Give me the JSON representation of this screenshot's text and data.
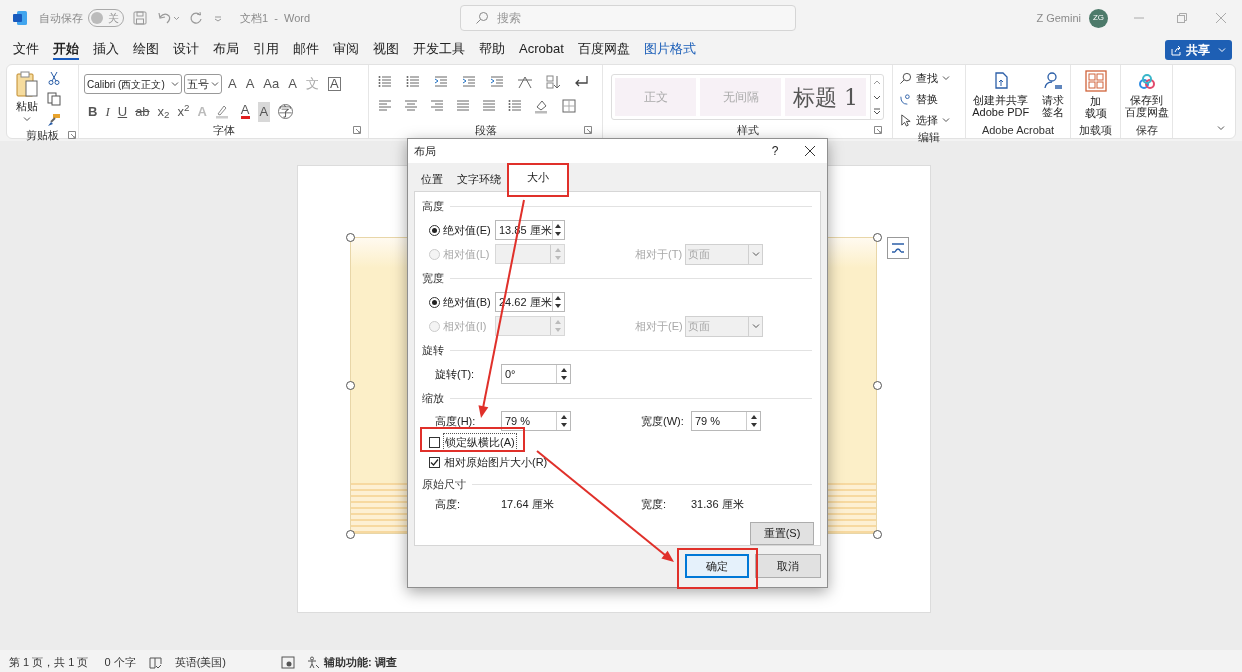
{
  "title_bar": {
    "autosave_label": "自动保存",
    "autosave": {
      "on": false,
      "label": "关"
    },
    "document_title": "文档1  -  Word",
    "search_placeholder": "搜索",
    "user_name": "Z Gemini",
    "avatar_initials": "ZG"
  },
  "menu_tabs": [
    {
      "label": "文件",
      "selected": false,
      "kind": "normal"
    },
    {
      "label": "开始",
      "selected": true,
      "kind": "normal"
    },
    {
      "label": "插入",
      "selected": false,
      "kind": "normal"
    },
    {
      "label": "绘图",
      "selected": false,
      "kind": "normal"
    },
    {
      "label": "设计",
      "selected": false,
      "kind": "normal"
    },
    {
      "label": "布局",
      "selected": false,
      "kind": "normal"
    },
    {
      "label": "引用",
      "selected": false,
      "kind": "normal"
    },
    {
      "label": "邮件",
      "selected": false,
      "kind": "normal"
    },
    {
      "label": "审阅",
      "selected": false,
      "kind": "normal"
    },
    {
      "label": "视图",
      "selected": false,
      "kind": "normal"
    },
    {
      "label": "开发工具",
      "selected": false,
      "kind": "normal"
    },
    {
      "label": "帮助",
      "selected": false,
      "kind": "normal"
    },
    {
      "label": "Acrobat",
      "selected": false,
      "kind": "normal"
    },
    {
      "label": "百度网盘",
      "selected": false,
      "kind": "normal"
    },
    {
      "label": "图片格式",
      "selected": false,
      "kind": "contextual"
    }
  ],
  "share_button": "共享",
  "ribbon": {
    "clipboard": {
      "paste_label": "粘贴",
      "group_label": "剪贴板"
    },
    "font": {
      "font_name": "Calibri (西文正文)",
      "font_size": "五号",
      "group_label": "字体",
      "tools_row1": [
        {
          "glyph": "A",
          "kind": "grow"
        },
        {
          "glyph": "A",
          "kind": "shrink"
        },
        {
          "glyph": "Aa",
          "kind": "case"
        },
        {
          "glyph": "A",
          "kind": "clear"
        },
        {
          "glyph": "文",
          "kind": "phonetic"
        },
        {
          "glyph": "A",
          "kind": "border"
        }
      ],
      "tools_row2": [
        {
          "glyph": "B",
          "kind": "bold"
        },
        {
          "glyph": "I",
          "kind": "italic"
        },
        {
          "glyph": "U",
          "kind": "underline"
        },
        {
          "glyph": "ab",
          "kind": "strike"
        },
        {
          "glyph": "x$_{2}$",
          "kind": "sub"
        },
        {
          "glyph": "x$^{2}$",
          "kind": "sup"
        },
        {
          "glyph": "A",
          "kind": "effects"
        },
        {
          "glyph": "A",
          "kind": "color"
        },
        {
          "glyph": "A",
          "kind": "shade"
        },
        {
          "glyph": "字",
          "kind": "enclose"
        }
      ]
    },
    "paragraph": {
      "group_label": "段落"
    },
    "styles": {
      "items": [
        {
          "label": "正文",
          "kind": "normal"
        },
        {
          "label": "无间隔",
          "kind": "normal"
        },
        {
          "label": "标题 1",
          "kind": "heading"
        }
      ],
      "group_label": "样式"
    },
    "editing": {
      "items": [
        {
          "label": "查找",
          "kind": "find"
        },
        {
          "label": "替换",
          "kind": "replace"
        },
        {
          "label": "选择",
          "kind": "select"
        }
      ],
      "group_label": "编辑"
    },
    "acrobat": {
      "buttons": [
        [
          "创建并共享",
          "Adobe PDF"
        ],
        [
          "请求",
          "签名"
        ]
      ],
      "group_label": "Adobe Acrobat"
    },
    "addins": {
      "button": [
        "加",
        "载项"
      ],
      "group_label": "加载项"
    },
    "save": {
      "button": [
        "保存到",
        "百度网盘"
      ],
      "group_label": "保存"
    }
  },
  "dialog": {
    "title": "布局",
    "help": "?",
    "tabs": [
      {
        "label": "位置",
        "selected": false
      },
      {
        "label": "文字环绕",
        "selected": false
      },
      {
        "label": "大小",
        "selected": true
      }
    ],
    "size_groups": [
      {
        "heading": "高度",
        "absolute": {
          "label": "绝对值(E)",
          "selected": true,
          "value": "13.85 厘米"
        },
        "relative": {
          "label": "相对值(L)",
          "selected": false,
          "disabled": true,
          "relative_to_label": "相对于(T)",
          "relative_to_value": "页面"
        }
      },
      {
        "heading": "宽度",
        "absolute": {
          "label": "绝对值(B)",
          "selected": true,
          "value": "24.62 厘米"
        },
        "relative": {
          "label": "相对值(I)",
          "selected": false,
          "disabled": true,
          "relative_to_label": "相对于(E)",
          "relative_to_value": "页面"
        }
      }
    ],
    "rotation": {
      "heading": "旋转",
      "label": "旋转(T):",
      "value": "0°"
    },
    "scale": {
      "heading": "缩放",
      "height_label": "高度(H):",
      "height_value": "79 %",
      "width_label": "宽度(W):",
      "width_value": "79 %",
      "checkboxes": [
        {
          "label": "锁定纵横比(A)",
          "checked": false
        },
        {
          "label": "相对原始图片大小(R)",
          "checked": true
        }
      ]
    },
    "original_size": {
      "heading": "原始尺寸",
      "height_label": "高度:",
      "height_value": "17.64 厘米",
      "width_label": "宽度:",
      "width_value": "31.36 厘米"
    },
    "reset_button": "重置(S)",
    "ok_button": "确定",
    "cancel_button": "取消"
  },
  "status_bar": {
    "page": "第 1 页，共 1 页",
    "words": "0 个字",
    "language": "英语(美国)",
    "accessibility": "辅助功能: 调查"
  }
}
